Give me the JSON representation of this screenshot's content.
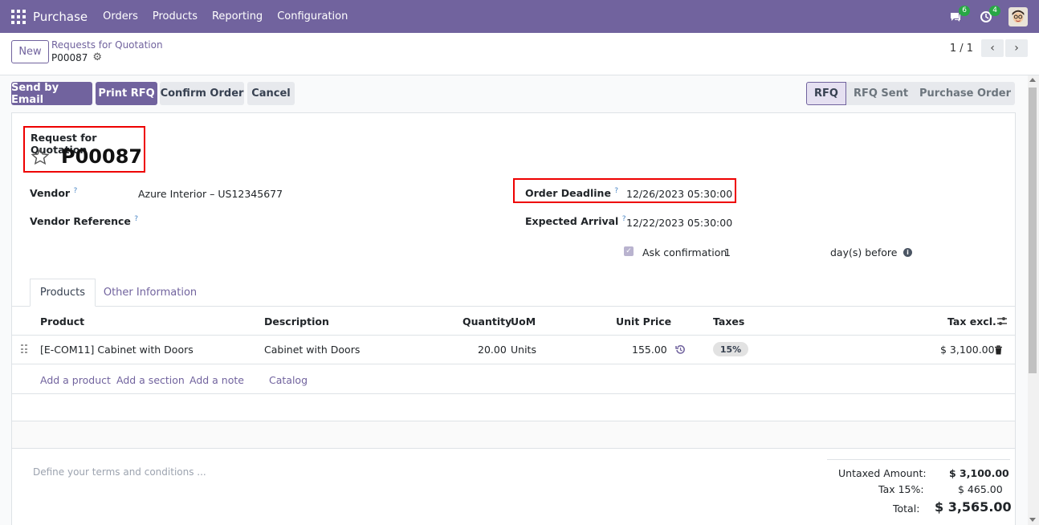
{
  "navbar": {
    "app_name": "Purchase",
    "menu": [
      "Orders",
      "Products",
      "Reporting",
      "Configuration"
    ],
    "messages_count": "6",
    "activities_count": "4",
    "background": "#71639e"
  },
  "control_panel": {
    "new_label": "New",
    "breadcrumb_parent": "Requests for Quotation",
    "breadcrumb_current": "P00087",
    "pager_value": "1 / 1"
  },
  "actions": {
    "send_email": "Send by Email",
    "print_rfq": "Print RFQ",
    "confirm_order": "Confirm Order",
    "cancel": "Cancel"
  },
  "status_stages": [
    "RFQ",
    "RFQ Sent",
    "Purchase Order"
  ],
  "active_stage": "RFQ",
  "form": {
    "title_small": "Request for Quotation",
    "title": "P00087",
    "vendor_label": "Vendor",
    "vendor_value": "Azure Interior – US12345677",
    "vendor_ref_label": "Vendor Reference",
    "vendor_ref_value": "",
    "order_deadline_label": "Order Deadline",
    "order_deadline_value": "12/26/2023 05:30:00",
    "expected_arrival_label": "Expected Arrival",
    "expected_arrival_value": "12/22/2023 05:30:00",
    "ask_confirmation_label": "Ask confirmation",
    "ask_confirmation_days": "1",
    "days_before_label": "day(s) before",
    "help_marker": "?"
  },
  "tabs": [
    "Products",
    "Other Information"
  ],
  "table": {
    "headers": {
      "product": "Product",
      "description": "Description",
      "quantity": "Quantity",
      "uom": "UoM",
      "unit_price": "Unit Price",
      "taxes": "Taxes",
      "tax_excl": "Tax excl."
    },
    "rows": [
      {
        "product": "[E-COM11] Cabinet with Doors",
        "description": "Cabinet with Doors",
        "quantity": "20.00",
        "uom": "Units",
        "unit_price": "155.00",
        "taxes": "15%",
        "tax_excl": "$ 3,100.00"
      }
    ],
    "add_product": "Add a product",
    "add_section": "Add a section",
    "add_note": "Add a note",
    "catalog": "Catalog"
  },
  "terms_placeholder": "Define your terms and conditions ...",
  "totals": {
    "untaxed_label": "Untaxed Amount:",
    "untaxed_value": "$ 3,100.00",
    "tax_label": "Tax 15%:",
    "tax_value": "$ 465.00",
    "total_label": "Total:",
    "total_value": "$ 3,565.00"
  }
}
